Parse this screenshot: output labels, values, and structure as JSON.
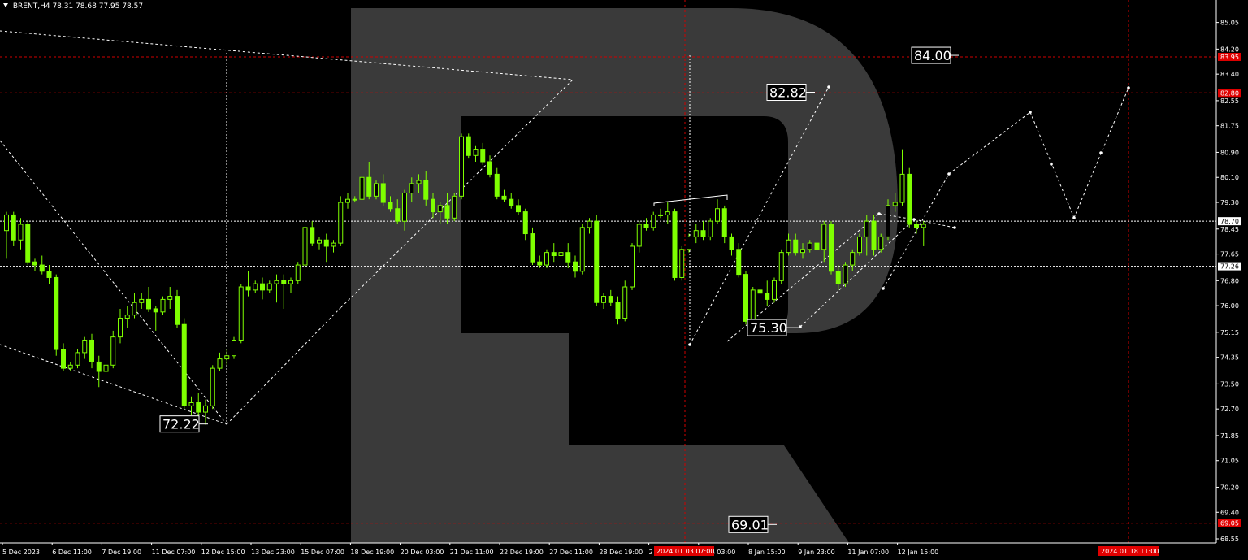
{
  "header": {
    "symbol": "BRENT,H4",
    "ohlc": "78.31 78.68 77.95 78.57"
  },
  "watermark": "R",
  "colors": {
    "background": "#000000",
    "candle": "#7fff00",
    "grid_red": "#d00000",
    "price_badge_red": "#e00000",
    "badge_white": "#ffffff"
  },
  "chart_data": {
    "type": "candlestick",
    "ylim": [
      68.55,
      85.3
    ],
    "price_axis": [
      "85.05",
      "84.20",
      "83.40",
      "82.55",
      "81.75",
      "80.90",
      "80.10",
      "79.30",
      "78.45",
      "77.65",
      "76.80",
      "76.00",
      "75.15",
      "74.35",
      "73.50",
      "72.70",
      "71.85",
      "71.05",
      "70.20",
      "69.40",
      "68.55"
    ],
    "time_axis": [
      "5 Dec 2023",
      "6 Dec 11:00",
      "7 Dec 19:00",
      "11 Dec 07:00",
      "12 Dec 15:00",
      "13 Dec 23:00",
      "15 Dec 07:00",
      "18 Dec 19:00",
      "20 Dec 03:00",
      "21 Dec 11:00",
      "22 Dec 19:00",
      "27 Dec 11:00",
      "28 Dec 19:00",
      "2 Jan 19:00",
      "5 Jan 03:00",
      "8 Jan 15:00",
      "9 Jan 23:00",
      "11 Jan 07:00",
      "12 Jan 15:00"
    ],
    "time_badges": [
      "2024.01.03 07:00",
      "2024.01.18 11:00"
    ],
    "horizontal_levels": [
      {
        "label": "83.95",
        "value": 83.95,
        "style": "red-dash",
        "badge": "red"
      },
      {
        "label": "82.80",
        "value": 82.8,
        "style": "red-dash",
        "badge": "red"
      },
      {
        "label": "78.70",
        "value": 78.7,
        "style": "white-dash",
        "badge": "white"
      },
      {
        "label": "77.26",
        "value": 77.26,
        "style": "white-dash",
        "badge": "white"
      },
      {
        "label": "69.05",
        "value": 69.05,
        "style": "red-dash",
        "badge": "red"
      }
    ],
    "annotations": [
      {
        "text": "84.00",
        "value": 84.0
      },
      {
        "text": "82.82",
        "value": 82.82
      },
      {
        "text": "75.30",
        "value": 75.3
      },
      {
        "text": "72.22",
        "value": 72.22
      },
      {
        "text": "69.01",
        "value": 69.01
      }
    ],
    "candles": [
      [
        78.4,
        79.0,
        77.5,
        78.9
      ],
      [
        78.9,
        79.0,
        77.9,
        78.1
      ],
      [
        78.1,
        78.8,
        77.8,
        78.6
      ],
      [
        78.6,
        78.7,
        77.3,
        77.4
      ],
      [
        77.4,
        77.5,
        77.1,
        77.3
      ],
      [
        77.3,
        77.6,
        77.0,
        77.1
      ],
      [
        77.1,
        77.3,
        76.7,
        76.9
      ],
      [
        76.9,
        77.0,
        74.4,
        74.6
      ],
      [
        74.6,
        74.8,
        73.9,
        74.0
      ],
      [
        74.0,
        74.2,
        73.9,
        74.1
      ],
      [
        74.1,
        74.6,
        74.0,
        74.5
      ],
      [
        74.5,
        75.0,
        74.3,
        74.9
      ],
      [
        74.9,
        75.1,
        74.0,
        74.2
      ],
      [
        74.2,
        74.4,
        73.4,
        73.9
      ],
      [
        73.9,
        74.2,
        73.7,
        74.1
      ],
      [
        74.1,
        75.2,
        74.0,
        75.0
      ],
      [
        75.0,
        75.9,
        74.8,
        75.6
      ],
      [
        75.6,
        76.0,
        75.3,
        75.7
      ],
      [
        75.7,
        76.4,
        75.6,
        76.1
      ],
      [
        76.1,
        76.4,
        75.9,
        76.2
      ],
      [
        76.2,
        76.6,
        75.8,
        75.9
      ],
      [
        75.9,
        76.0,
        75.2,
        75.8
      ],
      [
        75.8,
        76.3,
        75.7,
        76.2
      ],
      [
        76.2,
        76.6,
        75.9,
        76.3
      ],
      [
        76.3,
        76.5,
        75.3,
        75.4
      ],
      [
        75.4,
        75.6,
        72.7,
        72.8
      ],
      [
        72.8,
        73.1,
        72.5,
        72.9
      ],
      [
        72.9,
        73.2,
        72.4,
        72.6
      ],
      [
        72.6,
        73.0,
        72.2,
        72.8
      ],
      [
        72.8,
        74.1,
        72.7,
        74.0
      ],
      [
        74.0,
        74.5,
        73.9,
        74.3
      ],
      [
        74.3,
        74.6,
        74.1,
        74.4
      ],
      [
        74.4,
        75.0,
        74.3,
        74.9
      ],
      [
        74.9,
        76.7,
        74.8,
        76.6
      ],
      [
        76.6,
        77.1,
        76.3,
        76.5
      ],
      [
        76.5,
        76.8,
        76.4,
        76.7
      ],
      [
        76.7,
        76.9,
        76.2,
        76.5
      ],
      [
        76.5,
        76.8,
        76.4,
        76.7
      ],
      [
        76.7,
        77.0,
        76.1,
        76.8
      ],
      [
        76.8,
        77.0,
        75.9,
        76.7
      ],
      [
        76.7,
        76.9,
        76.4,
        76.8
      ],
      [
        76.8,
        77.4,
        76.7,
        77.3
      ],
      [
        77.3,
        79.4,
        77.1,
        78.5
      ],
      [
        78.5,
        78.7,
        77.9,
        78.0
      ],
      [
        78.0,
        78.2,
        77.8,
        78.1
      ],
      [
        78.1,
        78.3,
        77.4,
        77.9
      ],
      [
        77.9,
        78.1,
        77.7,
        78.0
      ],
      [
        78.0,
        79.5,
        77.9,
        79.3
      ],
      [
        79.3,
        79.6,
        79.1,
        79.4
      ],
      [
        79.4,
        79.5,
        79.3,
        79.4
      ],
      [
        79.4,
        80.3,
        79.3,
        80.1
      ],
      [
        80.1,
        80.6,
        79.4,
        79.5
      ],
      [
        79.5,
        80.0,
        79.4,
        79.9
      ],
      [
        79.9,
        80.2,
        79.2,
        79.3
      ],
      [
        79.3,
        79.5,
        79.0,
        79.1
      ],
      [
        79.1,
        79.4,
        78.6,
        78.7
      ],
      [
        78.7,
        79.7,
        78.4,
        79.6
      ],
      [
        79.6,
        80.1,
        79.3,
        79.9
      ],
      [
        79.9,
        80.2,
        79.6,
        80.0
      ],
      [
        80.0,
        80.3,
        79.2,
        79.4
      ],
      [
        79.4,
        79.6,
        78.8,
        79.0
      ],
      [
        79.0,
        79.3,
        78.6,
        79.2
      ],
      [
        79.2,
        79.6,
        78.6,
        78.8
      ],
      [
        78.8,
        79.6,
        78.7,
        79.5
      ],
      [
        79.5,
        81.5,
        79.4,
        81.4
      ],
      [
        81.4,
        81.5,
        80.7,
        80.8
      ],
      [
        80.8,
        81.1,
        80.6,
        81.0
      ],
      [
        81.0,
        81.2,
        80.5,
        80.6
      ],
      [
        80.6,
        80.8,
        80.1,
        80.2
      ],
      [
        80.2,
        80.4,
        79.4,
        79.5
      ],
      [
        79.5,
        79.7,
        79.3,
        79.4
      ],
      [
        79.4,
        79.6,
        79.1,
        79.2
      ],
      [
        79.2,
        79.4,
        78.9,
        79.0
      ],
      [
        79.0,
        79.1,
        78.1,
        78.3
      ],
      [
        78.3,
        78.5,
        77.3,
        77.4
      ],
      [
        77.4,
        77.6,
        77.2,
        77.3
      ],
      [
        77.3,
        77.8,
        77.2,
        77.7
      ],
      [
        77.7,
        78.0,
        77.4,
        77.6
      ],
      [
        77.6,
        77.8,
        77.3,
        77.7
      ],
      [
        77.7,
        78.0,
        77.2,
        77.4
      ],
      [
        77.4,
        77.6,
        76.9,
        77.1
      ],
      [
        77.1,
        78.6,
        77.0,
        78.5
      ],
      [
        78.5,
        78.8,
        78.3,
        78.7
      ],
      [
        78.7,
        78.9,
        76.0,
        76.1
      ],
      [
        76.1,
        76.4,
        75.9,
        76.3
      ],
      [
        76.3,
        76.5,
        76.0,
        76.1
      ],
      [
        76.1,
        76.3,
        75.4,
        75.6
      ],
      [
        75.6,
        76.8,
        75.5,
        76.6
      ],
      [
        76.6,
        78.0,
        76.5,
        77.9
      ],
      [
        77.9,
        78.7,
        77.7,
        78.6
      ],
      [
        78.6,
        78.8,
        78.4,
        78.5
      ],
      [
        78.5,
        79.0,
        78.4,
        78.9
      ],
      [
        78.9,
        79.1,
        78.8,
        78.9
      ],
      [
        78.9,
        79.3,
        78.6,
        79.0
      ],
      [
        79.0,
        79.1,
        76.8,
        76.9
      ],
      [
        76.9,
        77.9,
        76.8,
        77.8
      ],
      [
        77.8,
        78.3,
        77.7,
        78.2
      ],
      [
        78.2,
        78.6,
        78.0,
        78.4
      ],
      [
        78.4,
        78.7,
        78.1,
        78.2
      ],
      [
        78.2,
        78.8,
        78.1,
        78.7
      ],
      [
        78.7,
        79.4,
        78.6,
        79.1
      ],
      [
        79.1,
        79.2,
        78.0,
        78.2
      ],
      [
        78.2,
        78.3,
        77.6,
        77.8
      ],
      [
        77.8,
        78.0,
        76.9,
        77.0
      ],
      [
        77.0,
        77.1,
        75.4,
        75.5
      ],
      [
        75.5,
        76.6,
        75.4,
        76.5
      ],
      [
        76.5,
        76.9,
        76.2,
        76.4
      ],
      [
        76.4,
        76.8,
        76.0,
        76.2
      ],
      [
        76.2,
        76.9,
        76.1,
        76.8
      ],
      [
        76.8,
        77.8,
        76.7,
        77.7
      ],
      [
        77.7,
        78.3,
        77.6,
        78.1
      ],
      [
        78.1,
        78.3,
        77.6,
        77.7
      ],
      [
        77.7,
        78.0,
        77.5,
        77.8
      ],
      [
        77.8,
        78.1,
        77.7,
        78.0
      ],
      [
        78.0,
        78.2,
        77.6,
        77.8
      ],
      [
        77.8,
        78.7,
        77.4,
        78.6
      ],
      [
        78.6,
        78.7,
        77.0,
        77.1
      ],
      [
        77.1,
        77.3,
        76.5,
        76.7
      ],
      [
        76.7,
        77.4,
        76.6,
        77.3
      ],
      [
        77.3,
        77.8,
        77.1,
        77.7
      ],
      [
        77.7,
        78.3,
        77.6,
        78.2
      ],
      [
        78.2,
        78.9,
        77.6,
        78.7
      ],
      [
        78.7,
        78.9,
        77.6,
        77.8
      ],
      [
        77.8,
        78.3,
        77.7,
        78.2
      ],
      [
        78.2,
        79.4,
        78.1,
        79.2
      ],
      [
        79.2,
        79.6,
        79.0,
        79.3
      ],
      [
        79.3,
        81.0,
        79.2,
        80.2
      ],
      [
        80.2,
        80.4,
        78.5,
        78.6
      ],
      [
        78.6,
        78.7,
        78.3,
        78.5
      ],
      [
        78.5,
        78.7,
        77.9,
        78.6
      ]
    ],
    "forecast_path": [
      [
        80.02,
        82.82
      ],
      [
        83.0,
        75.3
      ],
      [
        84.0,
        77.7
      ],
      [
        85.0,
        84.0
      ]
    ]
  }
}
